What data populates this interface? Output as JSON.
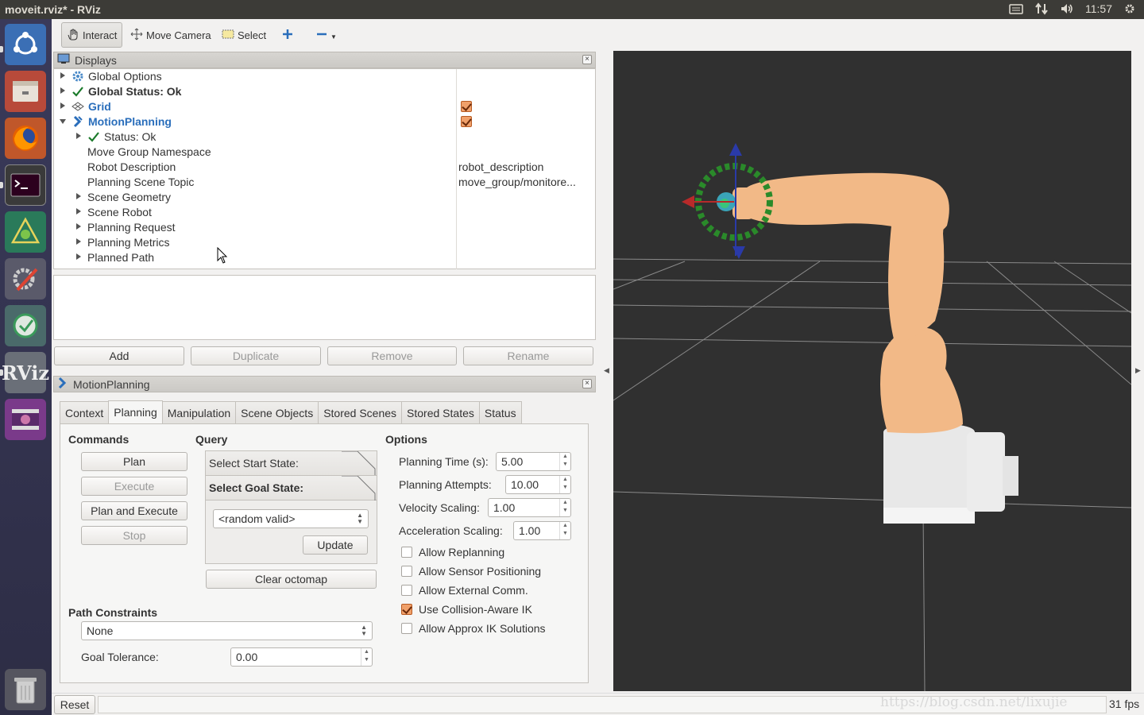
{
  "window": {
    "title": "moveit.rviz* - RViz",
    "clock": "11:57"
  },
  "toolbar": {
    "interact": "Interact",
    "move_camera": "Move Camera",
    "select": "Select"
  },
  "displays_panel": {
    "title": "Displays",
    "tree": [
      {
        "label": "Global Options",
        "value": ""
      },
      {
        "label": "Global Status: Ok",
        "value": ""
      },
      {
        "label": "Grid",
        "value": ""
      },
      {
        "label": "MotionPlanning",
        "value": ""
      },
      {
        "label": "Status: Ok",
        "value": ""
      },
      {
        "label": "Move Group Namespace",
        "value": ""
      },
      {
        "label": "Robot Description",
        "value": "robot_description"
      },
      {
        "label": "Planning Scene Topic",
        "value": "move_group/monitore..."
      },
      {
        "label": "Scene Geometry",
        "value": ""
      },
      {
        "label": "Scene Robot",
        "value": ""
      },
      {
        "label": "Planning Request",
        "value": ""
      },
      {
        "label": "Planning Metrics",
        "value": ""
      },
      {
        "label": "Planned Path",
        "value": ""
      }
    ],
    "buttons": {
      "add": "Add",
      "duplicate": "Duplicate",
      "remove": "Remove",
      "rename": "Rename"
    }
  },
  "motion_panel": {
    "title": "MotionPlanning",
    "tabs": [
      "Context",
      "Planning",
      "Manipulation",
      "Scene Objects",
      "Stored Scenes",
      "Stored States",
      "Status"
    ],
    "commands": {
      "title": "Commands",
      "plan": "Plan",
      "execute": "Execute",
      "plan_execute": "Plan and Execute",
      "stop": "Stop"
    },
    "query": {
      "title": "Query",
      "start_state": "Select Start State:",
      "goal_state": "Select Goal State:",
      "goal_select": "<random valid>",
      "update": "Update",
      "clear_octomap": "Clear octomap"
    },
    "options": {
      "title": "Options",
      "planning_time_label": "Planning Time (s):",
      "planning_time": "5.00",
      "planning_attempts_label": "Planning Attempts:",
      "planning_attempts": "10.00",
      "velocity_label": "Velocity Scaling:",
      "velocity": "1.00",
      "accel_label": "Acceleration Scaling:",
      "accel": "1.00",
      "allow_replanning": "Allow Replanning",
      "allow_sensor": "Allow Sensor Positioning",
      "allow_external": "Allow External Comm.",
      "collision_aware": "Use Collision-Aware IK",
      "approx_ik": "Allow Approx IK Solutions"
    },
    "path_constraints": {
      "title": "Path Constraints",
      "value": "None"
    },
    "goal_tolerance": {
      "label": "Goal Tolerance:",
      "value": "0.00"
    }
  },
  "status_bar": {
    "reset": "Reset",
    "fps": "31 fps",
    "watermark": "https://blog.csdn.net/lixujie"
  }
}
